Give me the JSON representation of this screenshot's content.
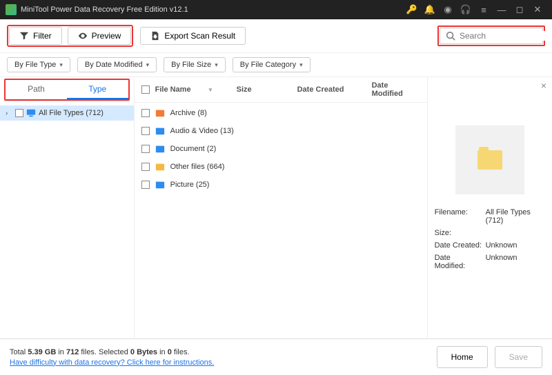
{
  "app": {
    "title": "MiniTool Power Data Recovery Free Edition v12.1"
  },
  "toolbar": {
    "filter": "Filter",
    "preview": "Preview",
    "export": "Export Scan Result",
    "search_placeholder": "Search"
  },
  "filters": {
    "by_type": "By File Type",
    "by_date": "By Date Modified",
    "by_size": "By File Size",
    "by_category": "By File Category"
  },
  "tabs": {
    "path": "Path",
    "type": "Type"
  },
  "tree": {
    "root": "All File Types (712)"
  },
  "columns": {
    "name": "File Name",
    "size": "Size",
    "dc": "Date Created",
    "dm": "Date Modified"
  },
  "files": [
    {
      "name": "Archive (8)",
      "color": "#f27b35"
    },
    {
      "name": "Audio & Video (13)",
      "color": "#2d8cf0"
    },
    {
      "name": "Document (2)",
      "color": "#2d8cf0"
    },
    {
      "name": "Other files (664)",
      "color": "#f5b942"
    },
    {
      "name": "Picture (25)",
      "color": "#2d8cf0"
    }
  ],
  "preview": {
    "k_filename": "Filename:",
    "v_filename": "All File Types (712)",
    "k_size": "Size:",
    "v_size": "",
    "k_dc": "Date Created:",
    "v_dc": "Unknown",
    "k_dm": "Date Modified:",
    "v_dm": "Unknown"
  },
  "footer": {
    "status_prefix": "Total ",
    "total_size": "5.39 GB",
    "status_mid1": " in ",
    "total_files": "712",
    "status_mid2": " files.   Selected ",
    "sel_bytes": "0 Bytes",
    "status_mid3": " in ",
    "sel_files": "0",
    "status_suffix": " files.",
    "help": "Have difficulty with data recovery? Click here for instructions.",
    "home": "Home",
    "save": "Save"
  }
}
